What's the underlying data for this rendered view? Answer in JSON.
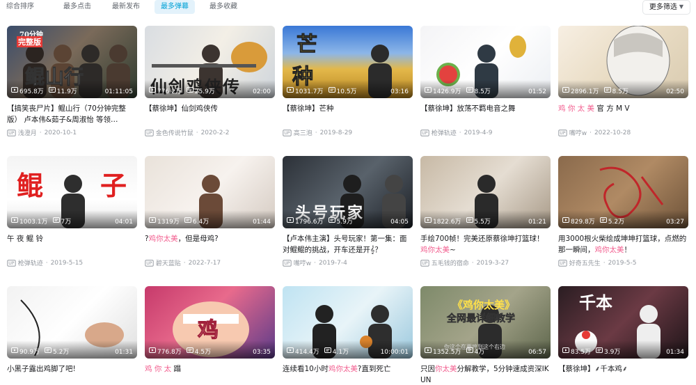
{
  "sort": {
    "tabs": [
      "综合排序",
      "最多点击",
      "最新发布",
      "最多弹幕",
      "最多收藏"
    ],
    "active_index": 3,
    "more_filter_label": "更多筛选"
  },
  "colors": {
    "accent": "#00a1d6",
    "highlight": "#f25d8e",
    "active_tab_bg": "#e3f2fb"
  },
  "videos": [
    {
      "views": "695.8万",
      "danmaku": "11.9万",
      "duration": "01:11:05",
      "title_parts": [
        {
          "t": "【搞笑丧尸片】鲲山行（70分钟完整版） 卢本伟&茹子&周淑怡 等领…"
        }
      ],
      "uploader": "浅澄月",
      "date": "2020-10-1",
      "overlay": [
        "70分钟",
        "完整版",
        "鲲山行"
      ]
    },
    {
      "views": "776.2万",
      "danmaku": "25.9万",
      "duration": "02:00",
      "title_parts": [
        {
          "t": "【蔡徐坤】仙剑鸡侠传"
        }
      ],
      "uploader": "金色传说竹鼠",
      "date": "2020-2-2",
      "overlay": [
        "仙剑鸡侠传"
      ]
    },
    {
      "views": "1031.7万",
      "danmaku": "10.5万",
      "duration": "03:16",
      "title_parts": [
        {
          "t": "【蔡徐坤】芒种"
        }
      ],
      "uploader": "高三泡",
      "date": "2019-8-29",
      "overlay": [
        "芒",
        "种"
      ]
    },
    {
      "views": "1426.9万",
      "danmaku": "8.5万",
      "duration": "01:52",
      "title_parts": [
        {
          "t": "【蔡徐坤】放荡不羁电音之舞"
        }
      ],
      "uploader": "枪弹轨迹",
      "date": "2019-4-9",
      "overlay": []
    },
    {
      "views": "2896.1万",
      "danmaku": "8.5万",
      "duration": "02:50",
      "title_parts": [
        {
          "t": "鸡 你 太 美",
          "hl": true
        },
        {
          "t": " 官 方 M V"
        }
      ],
      "uploader": "嘴哼w",
      "date": "2022-10-28",
      "overlay": []
    },
    {
      "views": "1003.1万",
      "danmaku": "7万",
      "duration": "04:01",
      "title_parts": [
        {
          "t": "午 夜 鲲 铃"
        }
      ],
      "uploader": "枪弹轨迹",
      "date": "2019-5-15",
      "overlay": [
        "鲲",
        "子"
      ]
    },
    {
      "views": "1319万",
      "danmaku": "6.4万",
      "duration": "01:44",
      "title_parts": [
        {
          "t": "?"
        },
        {
          "t": "鸡你太美",
          "hl": true
        },
        {
          "t": "，但是母鸡?"
        }
      ],
      "uploader": "碧天蓝贴",
      "date": "2022-7-17",
      "overlay": []
    },
    {
      "views": "1796.6万",
      "danmaku": "5.9万",
      "duration": "04:05",
      "title_parts": [
        {
          "t": "【卢本伟主演】头号玩家！第一集：面对鲲鲲的挑战，开车还是开𝄞？"
        }
      ],
      "uploader": "嘴哼w",
      "date": "2019-7-4",
      "overlay": [
        "头号玩家"
      ]
    },
    {
      "views": "1822.6万",
      "danmaku": "5.5万",
      "duration": "01:21",
      "title_parts": [
        {
          "t": "手绘700帧！完美还原蔡徐坤打篮球！"
        },
        {
          "t": "鸡你太美",
          "hl": true
        },
        {
          "t": "~"
        }
      ],
      "uploader": "五毛钱的宿命",
      "date": "2019-3-27",
      "overlay": []
    },
    {
      "views": "829.8万",
      "danmaku": "5.2万",
      "duration": "03:27",
      "title_parts": [
        {
          "t": "用3000根火柴绘成坤坤打篮球，点燃的那一瞬间，"
        },
        {
          "t": "鸡你太美",
          "hl": true
        },
        {
          "t": "！"
        }
      ],
      "uploader": "好奇五先生",
      "date": "2019-5-5",
      "overlay": []
    },
    {
      "views": "90.9万",
      "danmaku": "5.2万",
      "duration": "01:31",
      "title_parts": [
        {
          "t": "小黑子露出鸡脚了吧!"
        }
      ],
      "uploader": "",
      "date": "",
      "overlay": []
    },
    {
      "views": "776.8万",
      "danmaku": "4.5万",
      "duration": "03:35",
      "title_parts": [
        {
          "t": "鸡 你 太",
          "hl": true
        },
        {
          "t": " 蹋"
        }
      ],
      "uploader": "",
      "date": "",
      "overlay": [
        "鸡"
      ]
    },
    {
      "views": "414.4万",
      "danmaku": "4.1万",
      "duration": "10:00:01",
      "title_parts": [
        {
          "t": "连续看10小时"
        },
        {
          "t": "鸡你太美",
          "hl": true
        },
        {
          "t": "?直到死亡"
        }
      ],
      "uploader": "",
      "date": "",
      "overlay": []
    },
    {
      "views": "1352.5万",
      "danmaku": "4万",
      "duration": "06:57",
      "title_parts": [
        {
          "t": "只因"
        },
        {
          "t": "你太美",
          "hl": true
        },
        {
          "t": "分解教学，5分钟速成资深IKUN"
        }
      ],
      "uploader": "",
      "date": "",
      "overlay": [
        "《鸡你太美》",
        "全网最详细教学",
        "你这个在要哼到这个右边"
      ]
    },
    {
      "views": "83.5万",
      "danmaku": "3.9万",
      "duration": "01:34",
      "title_parts": [
        {
          "t": "【蔡徐坤】⸙千本鸡⸙"
        }
      ],
      "uploader": "",
      "date": "",
      "overlay": [
        "千本"
      ]
    }
  ]
}
